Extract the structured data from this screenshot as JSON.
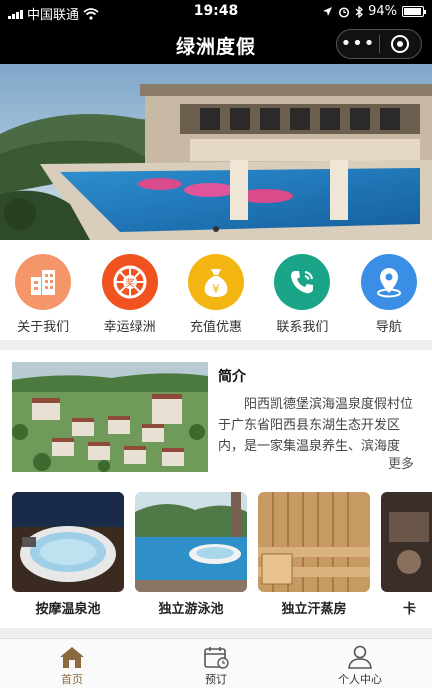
{
  "status_bar": {
    "carrier": "中国联通",
    "time": "19:48",
    "battery": "94%",
    "battery_level": 0.94
  },
  "nav": {
    "title": "绿洲度假",
    "more_label": "•••"
  },
  "menu": {
    "items": [
      {
        "label": "关于我们",
        "icon": "building-icon",
        "color": "#f4956a"
      },
      {
        "label": "幸运绿洲",
        "icon": "lottery-icon",
        "color": "#f0531f"
      },
      {
        "label": "充值优惠",
        "icon": "money-bag-icon",
        "color": "#f3b511"
      },
      {
        "label": "联系我们",
        "icon": "phone-icon",
        "color": "#1aa589"
      },
      {
        "label": "导航",
        "icon": "location-icon",
        "color": "#3a8ee6"
      }
    ]
  },
  "intro": {
    "title": "简介",
    "body": "阳西凯德堡滨海温泉度假村位于广东省阳西县东湖生态开发区内，是一家集温泉养生、滨海度",
    "more_label": "更多"
  },
  "facilities": [
    {
      "label": "按摩温泉池"
    },
    {
      "label": "独立游泳池"
    },
    {
      "label": "独立汗蒸房"
    },
    {
      "label": "卡"
    }
  ],
  "tabs": [
    {
      "label": "首页",
      "icon": "home-icon"
    },
    {
      "label": "预订",
      "icon": "calendar-icon"
    },
    {
      "label": "个人中心",
      "icon": "user-icon"
    }
  ],
  "colors": {
    "accent": "#8c6a3f",
    "nav_bg": "#000000"
  }
}
